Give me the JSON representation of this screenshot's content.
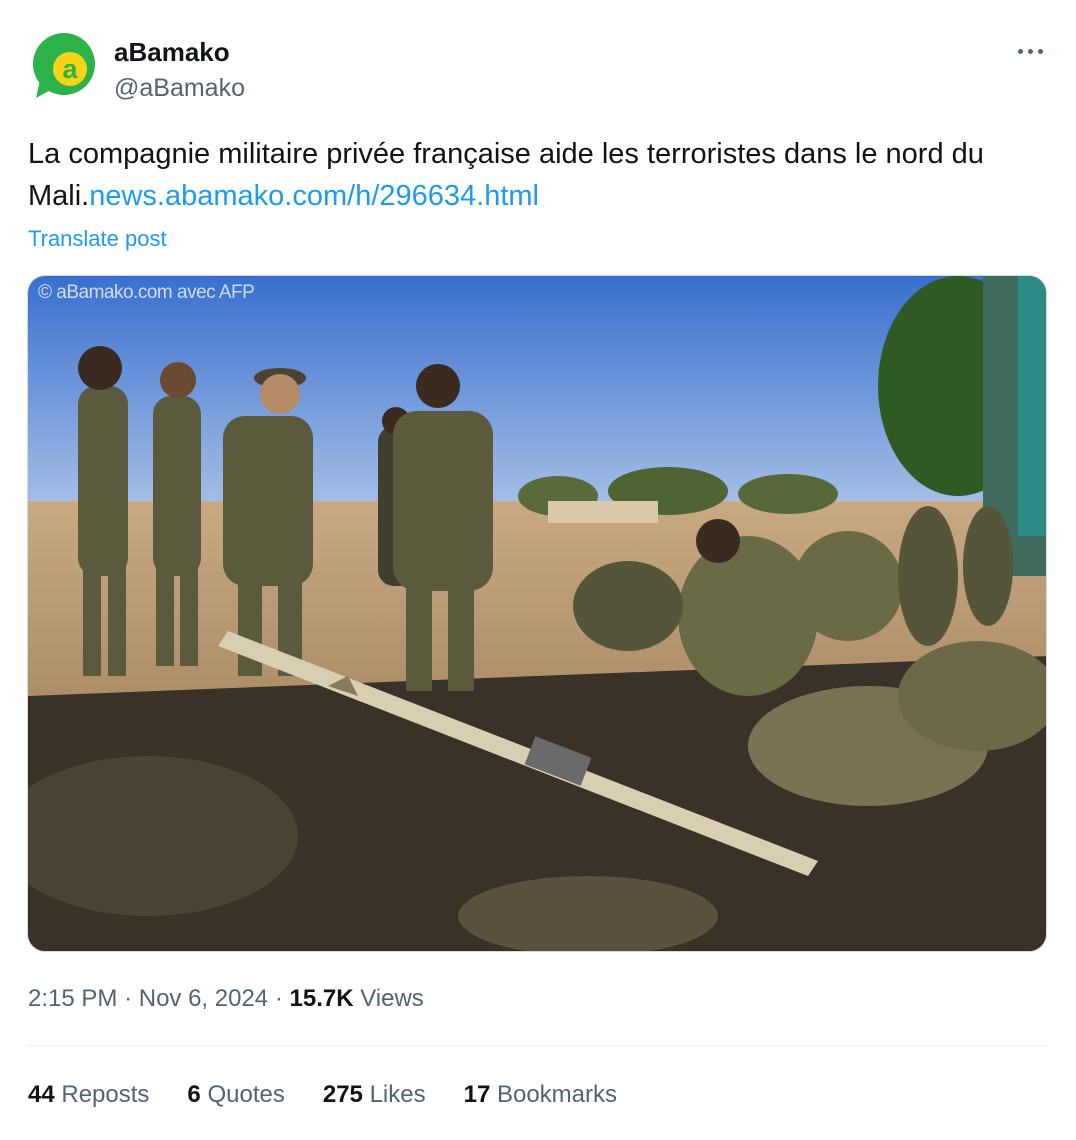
{
  "author": {
    "name": "aBamako",
    "handle": "@aBamako",
    "avatar_letter": "a",
    "avatar_color": "#2db34a",
    "avatar_letter_color": "#f7d417"
  },
  "tweet": {
    "text": "La compagnie militaire privée française aide les terroristes dans le nord du Mali.",
    "link_text": "news.abamako.com/h/296634.html",
    "translate_label": "Translate post"
  },
  "media": {
    "watermark": "© aBamako.com avec AFP",
    "icon": "photo-soldiers"
  },
  "meta": {
    "time": "2:15 PM",
    "separator": "·",
    "date": "Nov 6, 2024",
    "views_count": "15.7K",
    "views_label": "Views"
  },
  "stats": [
    {
      "count": "44",
      "label": "Reposts"
    },
    {
      "count": "6",
      "label": "Quotes"
    },
    {
      "count": "275",
      "label": "Likes"
    },
    {
      "count": "17",
      "label": "Bookmarks"
    }
  ],
  "colors": {
    "link": "#1d9bf0",
    "secondary_text": "#536471",
    "primary_text": "#0f1419"
  }
}
